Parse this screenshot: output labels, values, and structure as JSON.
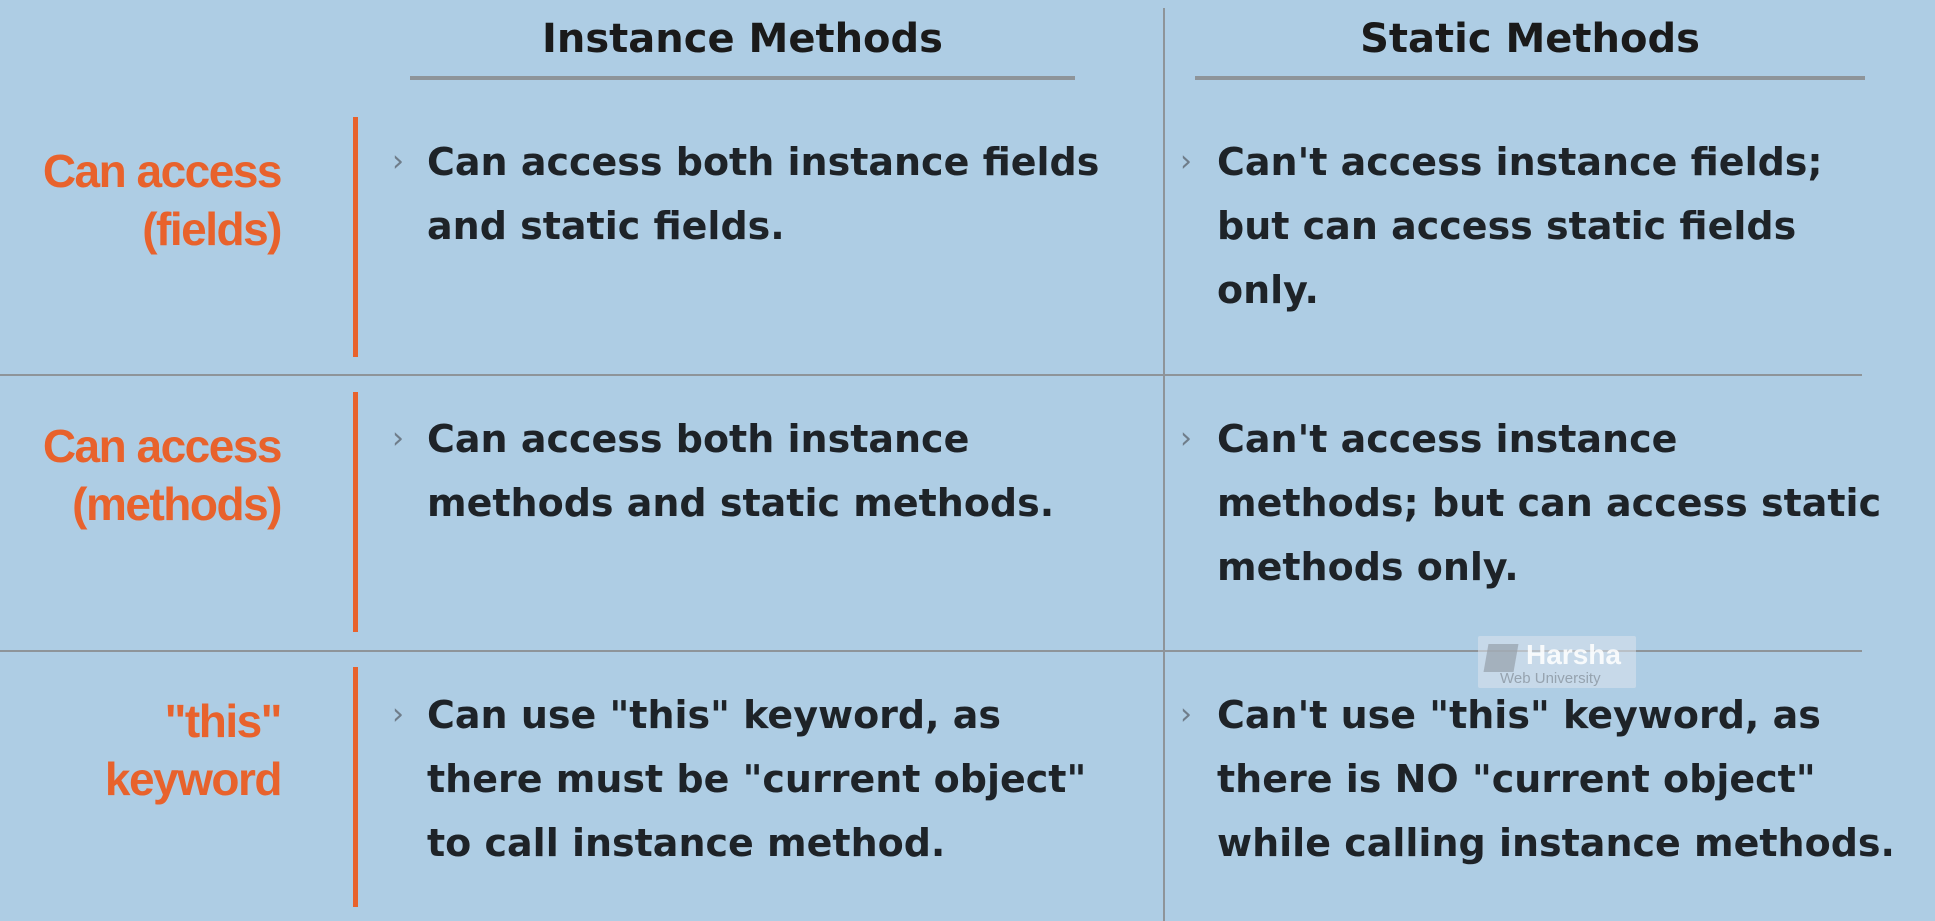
{
  "header": {
    "instance_title": "Instance Methods",
    "static_title": "Static Methods"
  },
  "rows": [
    {
      "label": "Can access\n(fields)",
      "instance": "Can access both instance fields\nand static fields.",
      "static": "Can't access instance fields;\nbut can access static fields\nonly."
    },
    {
      "label": "Can access\n(methods)",
      "instance": "Can access both instance\nmethods and static methods.",
      "static": "Can't access instance\nmethods; but can access static\nmethods only."
    },
    {
      "label": "\"this\"\nkeyword",
      "instance": "Can use \"this\" keyword, as\nthere must be \"current object\"\nto call instance method.",
      "static": "Can't use \"this\" keyword, as\nthere is NO \"current object\"\nwhile calling instance methods."
    }
  ],
  "bullet_glyph": "›",
  "watermark": {
    "title": "Harsha",
    "subtitle": "Web University"
  },
  "colors": {
    "background": "#aecde4",
    "accent": "#e8622c",
    "text": "#1e2328",
    "rule": "#8e9499"
  }
}
